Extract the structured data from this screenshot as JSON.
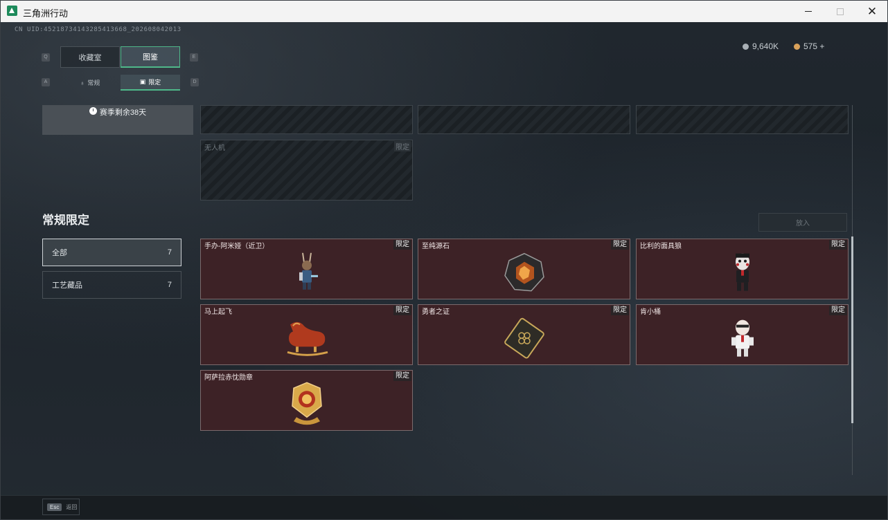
{
  "window": {
    "title": "三角洲行动"
  },
  "header": {
    "uid": "CN UID:4521873414328541366​8_2026080420​13",
    "currency": [
      {
        "value": "9,640K",
        "color": "#a9b0b6"
      },
      {
        "value": "575 +",
        "color": "#d9a15a"
      }
    ]
  },
  "tabs": [
    {
      "label": "收藏室",
      "key": "Q"
    },
    {
      "label": "图鉴",
      "key": "E",
      "active": true
    }
  ],
  "subtabs": [
    {
      "label": "常规",
      "key": "A"
    },
    {
      "label": "限定",
      "key": "D",
      "active": true
    }
  ],
  "season": {
    "label": "赛季剩余38天"
  },
  "locked_cards": [
    {
      "label": "",
      "tag": ""
    },
    {
      "label": "",
      "tag": ""
    },
    {
      "label": "",
      "tag": ""
    },
    {
      "label": "无人机",
      "tag": "限定"
    }
  ],
  "section": {
    "title": "常规限定"
  },
  "categories": [
    {
      "label": "全部",
      "count": "7",
      "active": true
    },
    {
      "label": "工艺藏品",
      "count": "7"
    }
  ],
  "sort_button": {
    "label": "放入"
  },
  "items": [
    {
      "name": "手办-阿米娅（近卫）",
      "tag": "限定",
      "icon": "figure-amiya-icon"
    },
    {
      "name": "至纯源石",
      "tag": "限定",
      "icon": "originium-icon"
    },
    {
      "name": "比利的面具狼",
      "tag": "限定",
      "icon": "billy-puppet-icon"
    },
    {
      "name": "马上起飞",
      "tag": "限定",
      "icon": "horse-icon"
    },
    {
      "name": "勇者之证",
      "tag": "限定",
      "icon": "card-icon"
    },
    {
      "name": "肯小桶",
      "tag": "限定",
      "icon": "colonel-figure-icon"
    },
    {
      "name": "阿萨拉赤忱勋章",
      "tag": "限定",
      "icon": "medal-icon"
    }
  ],
  "footer": {
    "esc_key": "Esc",
    "esc_label": "返回"
  }
}
